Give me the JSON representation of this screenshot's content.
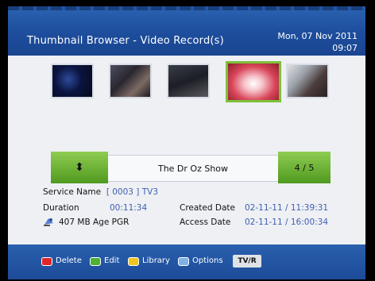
{
  "header": {
    "title": "Thumbnail Browser - Video Record(s)",
    "date": "Mon, 07 Nov 2011",
    "time": "09:07"
  },
  "thumbnails": {
    "count": 5,
    "selected_index": 3
  },
  "program_bar": {
    "updown_glyph": "⬍",
    "title": "The Dr Oz Show",
    "position": "4 / 5"
  },
  "info": {
    "service_name_label": "Service Name",
    "service_name_value": "[ 0003 ]  TV3",
    "duration_label": "Duration",
    "duration_value": "00:11:34",
    "created_label": "Created Date",
    "created_value": "02-11-11 / 11:39:31",
    "size_value": "407 MB",
    "age_label": "Age",
    "age_value": "PGR",
    "access_label": "Access Date",
    "access_value": "02-11-11 / 16:00:34"
  },
  "footer": {
    "keys": [
      {
        "label": "Delete",
        "color": "#e0262a"
      },
      {
        "label": "Edit",
        "color": "#4cb232"
      },
      {
        "label": "Library",
        "color": "#f2c51c"
      },
      {
        "label": "Options",
        "color": "#7fb3e8"
      }
    ],
    "tvr_label": "TV/R"
  }
}
